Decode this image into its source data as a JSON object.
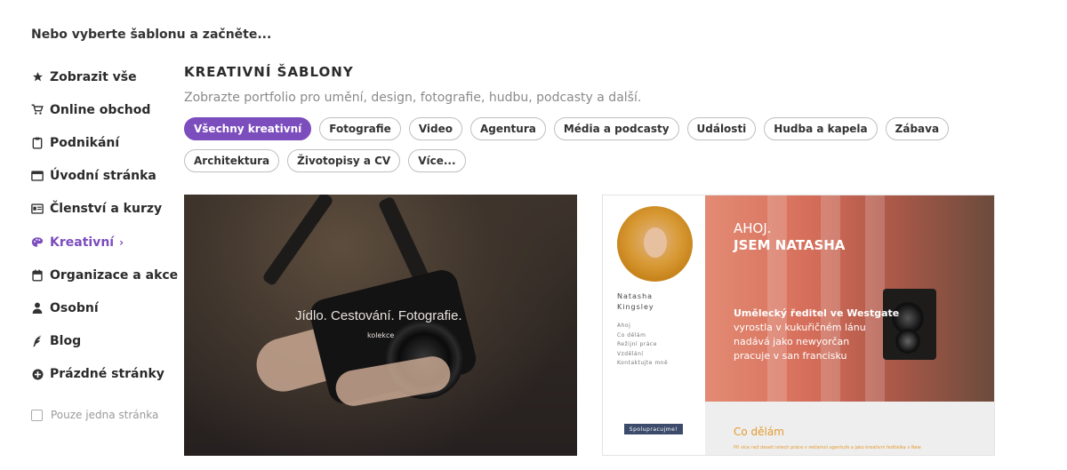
{
  "heading": "Nebo vyberte šablonu a začněte...",
  "sidebar": {
    "items": [
      {
        "label": "Zobrazit vše",
        "icon": "star-icon"
      },
      {
        "label": "Online obchod",
        "icon": "cart-icon"
      },
      {
        "label": "Podnikání",
        "icon": "clipboard-icon"
      },
      {
        "label": "Úvodní stránka",
        "icon": "window-icon"
      },
      {
        "label": "Členství a kurzy",
        "icon": "id-card-icon"
      },
      {
        "label": "Kreativní",
        "icon": "palette-icon",
        "active": true
      },
      {
        "label": "Organizace a akce",
        "icon": "calendar-icon"
      },
      {
        "label": "Osobní",
        "icon": "person-icon"
      },
      {
        "label": "Blog",
        "icon": "quill-icon"
      },
      {
        "label": "Prázdné stránky",
        "icon": "plus-circle-icon"
      }
    ],
    "single_page_label": "Pouze jedna stránka"
  },
  "main": {
    "title": "KREATIVNÍ ŠABLONY",
    "subtitle": "Zobrazte portfolio pro umění, design, fotografie, hudbu, podcasty a další.",
    "chips": [
      "Všechny kreativní",
      "Fotografie",
      "Video",
      "Agentura",
      "Média a podcasty",
      "Události",
      "Hudba a kapela",
      "Zábava",
      "Architektura",
      "Životopisy a CV",
      "Více..."
    ]
  },
  "templates": {
    "card1": {
      "headline": "Jídlo. Cestování. Fotografie.",
      "sub": "kolekce"
    },
    "card2": {
      "name_line1": "Natasha",
      "name_line2": "Kingsley",
      "menu": [
        "Ahoj",
        "Co dělám",
        "Režijní práce",
        "Vzdělání",
        "Kontaktujte mně"
      ],
      "button": "Spolupracujme!",
      "hello": "AHOJ.",
      "iam": "JSEM NATASHA",
      "bio_bold": "Umělecký ředitel ve Westgate",
      "bio_1": "vyrostla v kukuřičném lánu",
      "bio_2": "nadává jako newyorčan",
      "bio_3": "pracuje v san francisku",
      "section": "Co dělám",
      "section_text": "Při více než deseti letech práce v reklamní agentuře a jako kreativní ředitelka v New"
    }
  },
  "colors": {
    "accent": "#7c4dbd"
  }
}
